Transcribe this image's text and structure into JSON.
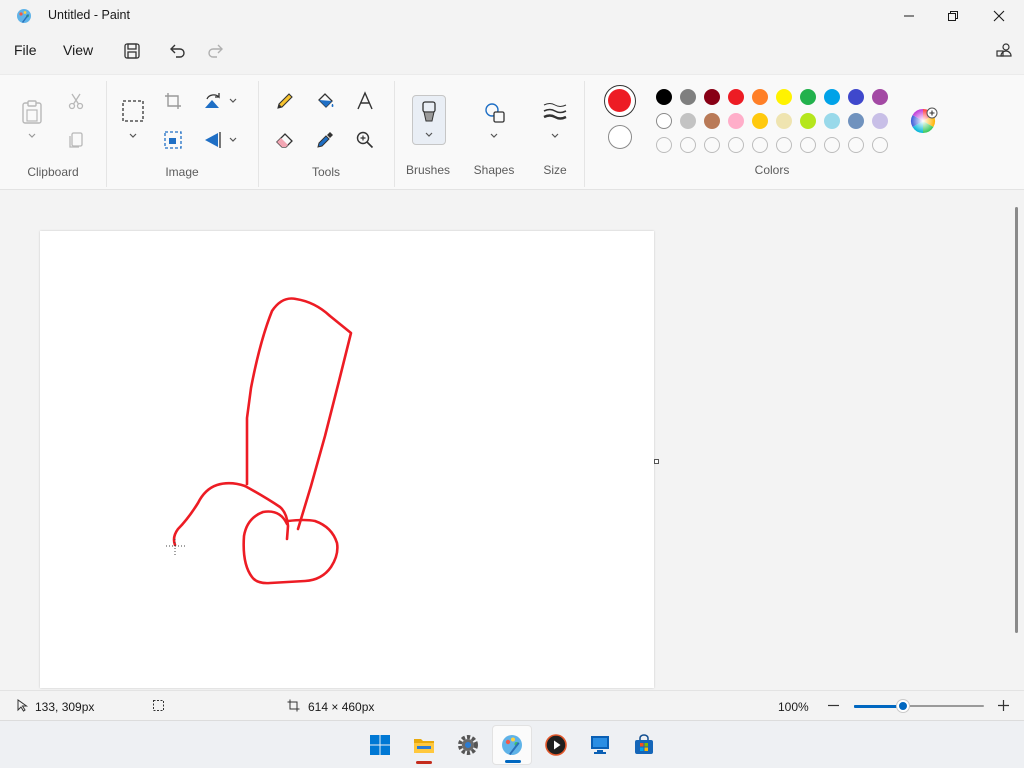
{
  "window": {
    "title": "Untitled - Paint"
  },
  "menu": {
    "file": "File",
    "view": "View"
  },
  "ribbon": {
    "groups": {
      "clipboard": "Clipboard",
      "image": "Image",
      "tools": "Tools",
      "brushes": "Brushes",
      "shapes": "Shapes",
      "size": "Size",
      "colors": "Colors"
    }
  },
  "colors": {
    "primary": "#ed1c24",
    "secondary": "#ffffff",
    "palette_row1": [
      "#000000",
      "#7f7f7f",
      "#880015",
      "#ed1c24",
      "#ff7f27",
      "#fff200",
      "#22b14c",
      "#00a2e8",
      "#3f48cc",
      "#a349a4"
    ],
    "palette_row2": [
      "#ffffff",
      "#c3c3c3",
      "#b97a57",
      "#ffaec9",
      "#ffc90e",
      "#efe4b0",
      "#b5e61d",
      "#99d9ea",
      "#7092be",
      "#c8bfe7"
    ],
    "palette_row3_empty_count": 10
  },
  "status": {
    "cursor_position": "133, 309px",
    "canvas_size": "614 × 460px",
    "zoom": "100%",
    "zoom_fraction": 0.5
  },
  "taskbar": {
    "items": [
      "start-icon",
      "file-explorer-icon",
      "settings-icon",
      "paint-icon",
      "media-player-icon",
      "remote-desktop-icon",
      "store-icon"
    ]
  }
}
